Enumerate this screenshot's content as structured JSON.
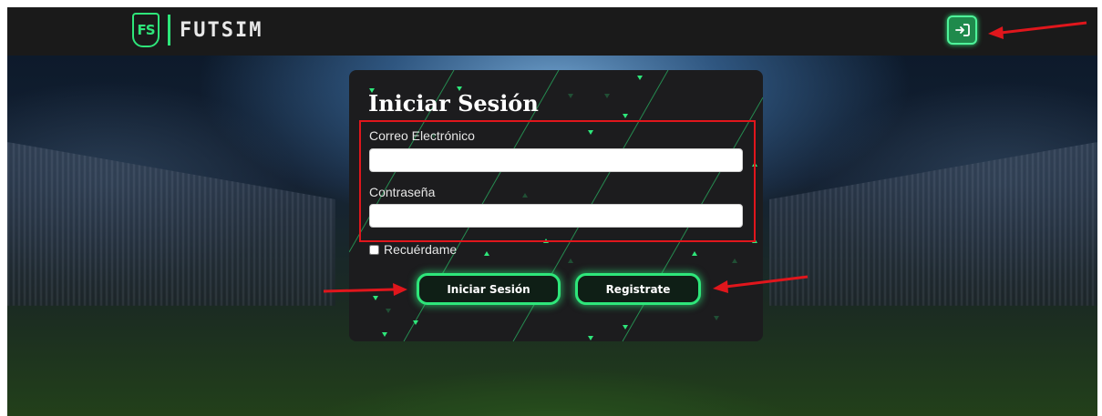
{
  "app": {
    "logo_mark": "FS",
    "name": "FUTSIM"
  },
  "header": {
    "login_button_icon": "login-icon"
  },
  "login_form": {
    "title": "Iniciar Sesión",
    "email_label": "Correo Electrónico",
    "email_value": "",
    "password_label": "Contraseña",
    "password_value": "",
    "remember_label": "Recuérdame",
    "remember_checked": false,
    "submit_label": "Iniciar Sesión",
    "register_label": "Registrate"
  },
  "colors": {
    "accent": "#2ee67a",
    "navbar": "#1a1a1a",
    "card": "#1c1c1e",
    "annotation": "#e0161c"
  }
}
